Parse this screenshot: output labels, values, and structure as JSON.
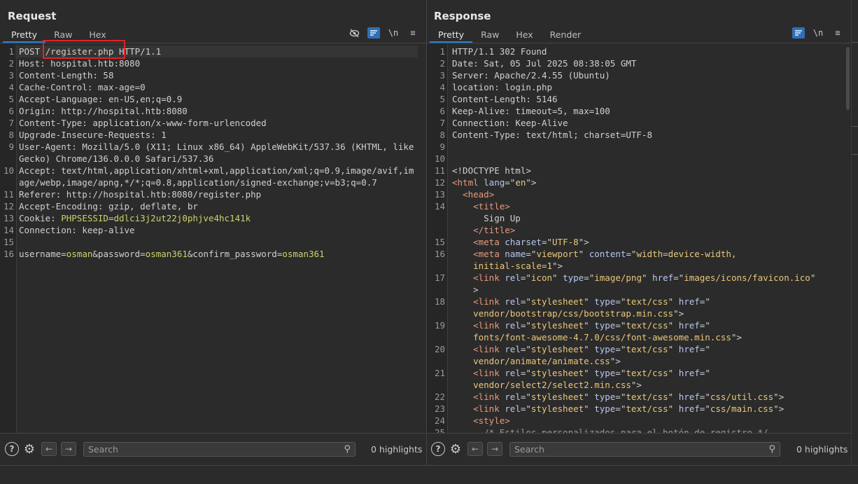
{
  "request": {
    "title": "Request",
    "tabs": [
      {
        "label": "Pretty",
        "active": true
      },
      {
        "label": "Raw"
      },
      {
        "label": "Hex"
      }
    ],
    "toolbar": {
      "newline_label": "\\n",
      "menu_label": "≡"
    },
    "lines": [
      {
        "n": "1",
        "text": "POST /register.php HTTP/1.1"
      },
      {
        "n": "2",
        "k": "Host: ",
        "v": "hospital.htb:8080"
      },
      {
        "n": "3",
        "k": "Content-Length: ",
        "v": "58"
      },
      {
        "n": "4",
        "k": "Cache-Control: ",
        "v": "max-age=0"
      },
      {
        "n": "5",
        "k": "Accept-Language: ",
        "v": "en-US,en;q=0.9"
      },
      {
        "n": "6",
        "k": "Origin: ",
        "v": "http://hospital.htb:8080"
      },
      {
        "n": "7",
        "k": "Content-Type: ",
        "v": "application/x-www-form-urlencoded"
      },
      {
        "n": "8",
        "k": "Upgrade-Insecure-Requests: ",
        "v": "1"
      },
      {
        "n": "9",
        "k": "User-Agent: ",
        "v": "Mozilla/5.0 (X11; Linux x86_64) AppleWebKit/537.36 (KHTML, like Gecko) Chrome/136.0.0.0 Safari/537.36"
      },
      {
        "n": "10",
        "k": "Accept: ",
        "v": "text/html,application/xhtml+xml,application/xml;q=0.9,image/avif,image/webp,image/apng,*/*;q=0.8,application/signed-exchange;v=b3;q=0.7"
      },
      {
        "n": "11",
        "k": "Referer: ",
        "v": "http://hospital.htb:8080/register.php"
      },
      {
        "n": "12",
        "k": "Accept-Encoding: ",
        "v": "gzip, deflate, br"
      },
      {
        "n": "13",
        "k": "Cookie: ",
        "ck": "PHPSESSID",
        "eq": "=",
        "cv": "ddlci3j2ut22j0phjve4hc141k"
      },
      {
        "n": "14",
        "k": "Connection: ",
        "v": "keep-alive"
      },
      {
        "n": "15",
        "text": ""
      },
      {
        "n": "16",
        "params": [
          {
            "name": "username",
            "value": "osman"
          },
          {
            "name": "password",
            "value": "osman361"
          },
          {
            "name": "confirm_password",
            "value": "osman361"
          }
        ]
      }
    ],
    "search_placeholder": "Search",
    "highlights": "0 highlights"
  },
  "response": {
    "title": "Response",
    "tabs": [
      {
        "label": "Pretty",
        "active": true
      },
      {
        "label": "Raw"
      },
      {
        "label": "Hex"
      },
      {
        "label": "Render"
      }
    ],
    "toolbar": {
      "newline_label": "\\n",
      "menu_label": "≡"
    },
    "lines": [
      {
        "n": "1",
        "text": "HTTP/1.1 302 Found"
      },
      {
        "n": "2",
        "k": "Date: ",
        "v": "Sat, 05 Jul 2025 08:38:05 GMT"
      },
      {
        "n": "3",
        "k": "Server: ",
        "v": "Apache/2.4.55 (Ubuntu)"
      },
      {
        "n": "4",
        "k": "location: ",
        "v": "login.php"
      },
      {
        "n": "5",
        "k": "Content-Length: ",
        "v": "5146"
      },
      {
        "n": "6",
        "k": "Keep-Alive: ",
        "v": "timeout=5, max=100"
      },
      {
        "n": "7",
        "k": "Connection: ",
        "v": "Keep-Alive"
      },
      {
        "n": "8",
        "k": "Content-Type: ",
        "v": "text/html; charset=UTF-8"
      },
      {
        "n": "9",
        "text": ""
      },
      {
        "n": "10",
        "text": ""
      },
      {
        "n": "11",
        "html": [
          {
            "t": "<!DOCTYPE html>",
            "c": "plain"
          }
        ]
      },
      {
        "n": "12",
        "html": [
          {
            "t": "<html ",
            "c": "tag"
          },
          {
            "t": "lang",
            "c": "attr"
          },
          {
            "t": "=\"",
            "c": "plain"
          },
          {
            "t": "en",
            "c": "str"
          },
          {
            "t": "\">",
            "c": "plain"
          }
        ]
      },
      {
        "n": "13",
        "html": [
          {
            "t": "  <head>",
            "c": "tag"
          }
        ]
      },
      {
        "n": "14",
        "html": [
          {
            "t": "    <title>",
            "c": "tag"
          },
          {
            "t": "\n      Sign Up\n    ",
            "c": "plain"
          },
          {
            "t": "</title>",
            "c": "tag"
          }
        ]
      },
      {
        "n": "15",
        "html": [
          {
            "t": "    <meta ",
            "c": "tag"
          },
          {
            "t": "charset",
            "c": "attr"
          },
          {
            "t": "=\"",
            "c": "plain"
          },
          {
            "t": "UTF-8",
            "c": "str"
          },
          {
            "t": "\">",
            "c": "plain"
          }
        ]
      },
      {
        "n": "16",
        "html": [
          {
            "t": "    <meta ",
            "c": "tag"
          },
          {
            "t": "name",
            "c": "attr"
          },
          {
            "t": "=\"",
            "c": "plain"
          },
          {
            "t": "viewport",
            "c": "str"
          },
          {
            "t": "\" ",
            "c": "plain"
          },
          {
            "t": "content",
            "c": "attr"
          },
          {
            "t": "=\"",
            "c": "plain"
          },
          {
            "t": "width=device-width,\n    initial-scale=1",
            "c": "str"
          },
          {
            "t": "\">",
            "c": "plain"
          }
        ]
      },
      {
        "n": "17",
        "html": [
          {
            "t": "    <link ",
            "c": "tag"
          },
          {
            "t": "rel",
            "c": "attr"
          },
          {
            "t": "=\"",
            "c": "plain"
          },
          {
            "t": "icon",
            "c": "str"
          },
          {
            "t": "\" ",
            "c": "plain"
          },
          {
            "t": "type",
            "c": "attr"
          },
          {
            "t": "=\"",
            "c": "plain"
          },
          {
            "t": "image/png",
            "c": "str"
          },
          {
            "t": "\" ",
            "c": "plain"
          },
          {
            "t": "href",
            "c": "attr"
          },
          {
            "t": "=\"",
            "c": "plain"
          },
          {
            "t": "images/icons/favicon.ico",
            "c": "str"
          },
          {
            "t": "\"\n    >",
            "c": "plain"
          }
        ]
      },
      {
        "n": "18",
        "html": [
          {
            "t": "    <link ",
            "c": "tag"
          },
          {
            "t": "rel",
            "c": "attr"
          },
          {
            "t": "=\"",
            "c": "plain"
          },
          {
            "t": "stylesheet",
            "c": "str"
          },
          {
            "t": "\" ",
            "c": "plain"
          },
          {
            "t": "type",
            "c": "attr"
          },
          {
            "t": "=\"",
            "c": "plain"
          },
          {
            "t": "text/css",
            "c": "str"
          },
          {
            "t": "\" ",
            "c": "plain"
          },
          {
            "t": "href",
            "c": "attr"
          },
          {
            "t": "=\"\n    ",
            "c": "plain"
          },
          {
            "t": "vendor/bootstrap/css/bootstrap.min.css",
            "c": "str"
          },
          {
            "t": "\">",
            "c": "plain"
          }
        ]
      },
      {
        "n": "19",
        "html": [
          {
            "t": "    <link ",
            "c": "tag"
          },
          {
            "t": "rel",
            "c": "attr"
          },
          {
            "t": "=\"",
            "c": "plain"
          },
          {
            "t": "stylesheet",
            "c": "str"
          },
          {
            "t": "\" ",
            "c": "plain"
          },
          {
            "t": "type",
            "c": "attr"
          },
          {
            "t": "=\"",
            "c": "plain"
          },
          {
            "t": "text/css",
            "c": "str"
          },
          {
            "t": "\" ",
            "c": "plain"
          },
          {
            "t": "href",
            "c": "attr"
          },
          {
            "t": "=\"\n    ",
            "c": "plain"
          },
          {
            "t": "fonts/font-awesome-4.7.0/css/font-awesome.min.css",
            "c": "str"
          },
          {
            "t": "\">",
            "c": "plain"
          }
        ]
      },
      {
        "n": "20",
        "html": [
          {
            "t": "    <link ",
            "c": "tag"
          },
          {
            "t": "rel",
            "c": "attr"
          },
          {
            "t": "=\"",
            "c": "plain"
          },
          {
            "t": "stylesheet",
            "c": "str"
          },
          {
            "t": "\" ",
            "c": "plain"
          },
          {
            "t": "type",
            "c": "attr"
          },
          {
            "t": "=\"",
            "c": "plain"
          },
          {
            "t": "text/css",
            "c": "str"
          },
          {
            "t": "\" ",
            "c": "plain"
          },
          {
            "t": "href",
            "c": "attr"
          },
          {
            "t": "=\"\n    ",
            "c": "plain"
          },
          {
            "t": "vendor/animate/animate.css",
            "c": "str"
          },
          {
            "t": "\">",
            "c": "plain"
          }
        ]
      },
      {
        "n": "21",
        "html": [
          {
            "t": "    <link ",
            "c": "tag"
          },
          {
            "t": "rel",
            "c": "attr"
          },
          {
            "t": "=\"",
            "c": "plain"
          },
          {
            "t": "stylesheet",
            "c": "str"
          },
          {
            "t": "\" ",
            "c": "plain"
          },
          {
            "t": "type",
            "c": "attr"
          },
          {
            "t": "=\"",
            "c": "plain"
          },
          {
            "t": "text/css",
            "c": "str"
          },
          {
            "t": "\" ",
            "c": "plain"
          },
          {
            "t": "href",
            "c": "attr"
          },
          {
            "t": "=\"\n    ",
            "c": "plain"
          },
          {
            "t": "vendor/select2/select2.min.css",
            "c": "str"
          },
          {
            "t": "\">",
            "c": "plain"
          }
        ]
      },
      {
        "n": "22",
        "html": [
          {
            "t": "    <link ",
            "c": "tag"
          },
          {
            "t": "rel",
            "c": "attr"
          },
          {
            "t": "=\"",
            "c": "plain"
          },
          {
            "t": "stylesheet",
            "c": "str"
          },
          {
            "t": "\" ",
            "c": "plain"
          },
          {
            "t": "type",
            "c": "attr"
          },
          {
            "t": "=\"",
            "c": "plain"
          },
          {
            "t": "text/css",
            "c": "str"
          },
          {
            "t": "\" ",
            "c": "plain"
          },
          {
            "t": "href",
            "c": "attr"
          },
          {
            "t": "=\"",
            "c": "plain"
          },
          {
            "t": "css/util.css",
            "c": "str"
          },
          {
            "t": "\">",
            "c": "plain"
          }
        ]
      },
      {
        "n": "23",
        "html": [
          {
            "t": "    <link ",
            "c": "tag"
          },
          {
            "t": "rel",
            "c": "attr"
          },
          {
            "t": "=\"",
            "c": "plain"
          },
          {
            "t": "stylesheet",
            "c": "str"
          },
          {
            "t": "\" ",
            "c": "plain"
          },
          {
            "t": "type",
            "c": "attr"
          },
          {
            "t": "=\"",
            "c": "plain"
          },
          {
            "t": "text/css",
            "c": "str"
          },
          {
            "t": "\" ",
            "c": "plain"
          },
          {
            "t": "href",
            "c": "attr"
          },
          {
            "t": "=\"",
            "c": "plain"
          },
          {
            "t": "css/main.css",
            "c": "str"
          },
          {
            "t": "\">",
            "c": "plain"
          }
        ]
      },
      {
        "n": "24",
        "html": [
          {
            "t": "    <style>",
            "c": "tag"
          }
        ]
      },
      {
        "n": "25",
        "html": [
          {
            "t": "      /* Estilos personalizados para el botón de registro */",
            "c": "cmt"
          }
        ]
      }
    ],
    "search_placeholder": "Search",
    "highlights": "0 highlights"
  },
  "colors": {
    "accent": "#2f6fb8",
    "highlight_box": "#e02424"
  }
}
